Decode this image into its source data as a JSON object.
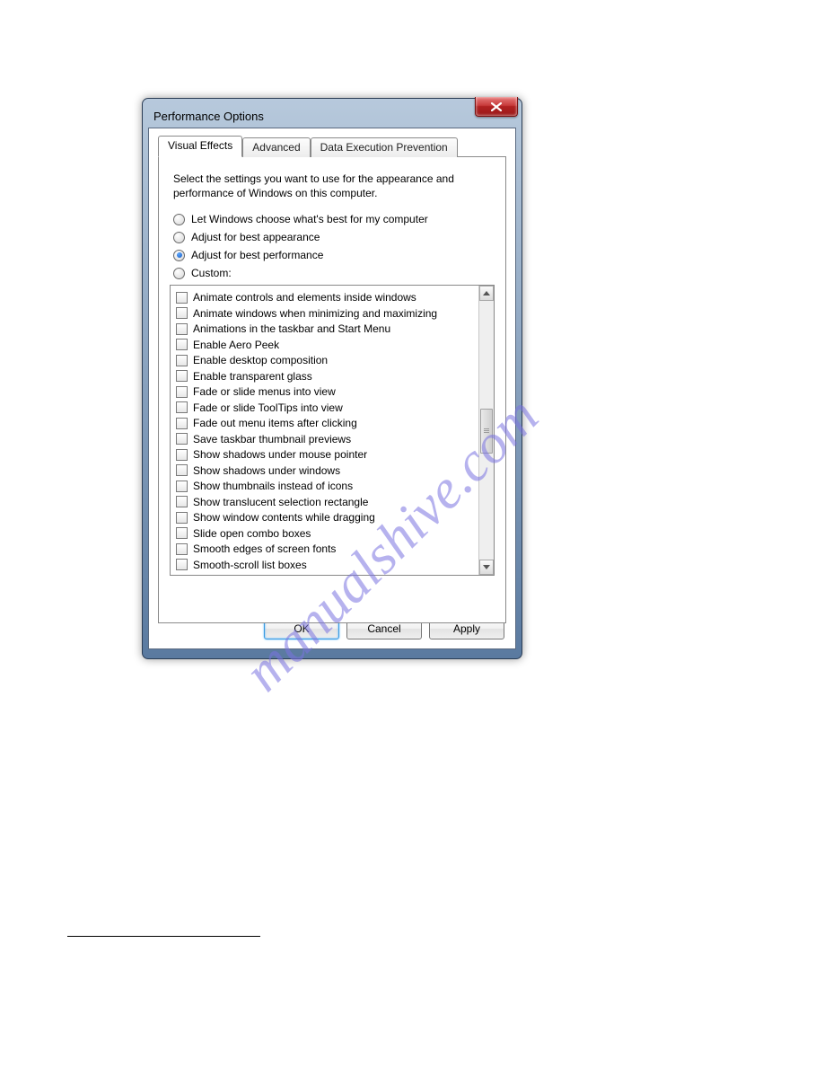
{
  "dialog": {
    "title": "Performance Options",
    "tabs": [
      {
        "label": "Visual Effects",
        "active": true
      },
      {
        "label": "Advanced",
        "active": false
      },
      {
        "label": "Data Execution Prevention",
        "active": false
      }
    ],
    "intro": "Select the settings you want to use for the appearance and performance of Windows on this computer.",
    "radios": [
      {
        "label": "Let Windows choose what's best for my computer",
        "selected": false
      },
      {
        "label": "Adjust for best appearance",
        "selected": false
      },
      {
        "label": "Adjust for best performance",
        "selected": true
      },
      {
        "label": "Custom:",
        "selected": false
      }
    ],
    "options": [
      "Animate controls and elements inside windows",
      "Animate windows when minimizing and maximizing",
      "Animations in the taskbar and Start Menu",
      "Enable Aero Peek",
      "Enable desktop composition",
      "Enable transparent glass",
      "Fade or slide menus into view",
      "Fade or slide ToolTips into view",
      "Fade out menu items after clicking",
      "Save taskbar thumbnail previews",
      "Show shadows under mouse pointer",
      "Show shadows under windows",
      "Show thumbnails instead of icons",
      "Show translucent selection rectangle",
      "Show window contents while dragging",
      "Slide open combo boxes",
      "Smooth edges of screen fonts",
      "Smooth-scroll list boxes"
    ],
    "buttons": {
      "ok": "OK",
      "cancel": "Cancel",
      "apply": "Apply"
    }
  },
  "watermark": "manualshive.com"
}
